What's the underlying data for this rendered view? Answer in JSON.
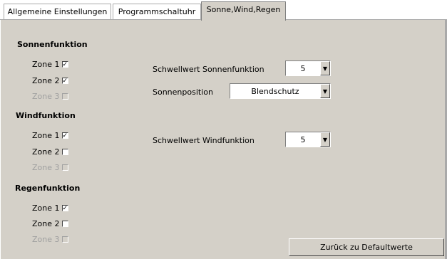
{
  "tabs": [
    {
      "label": "Allgemeine Einstellungen"
    },
    {
      "label": "Programmschaltuhr"
    },
    {
      "label": "Sonne,Wind,Regen"
    }
  ],
  "sonne": {
    "title": "Sonnenfunktion",
    "zones": [
      {
        "label": "Zone 1",
        "checked": true,
        "enabled": true
      },
      {
        "label": "Zone 2",
        "checked": true,
        "enabled": true
      },
      {
        "label": "Zone 3",
        "checked": false,
        "enabled": false
      }
    ],
    "threshold_label": "Schwellwert Sonnenfunktion",
    "threshold_value": "5",
    "position_label": "Sonnenposition",
    "position_value": "Blendschutz"
  },
  "wind": {
    "title": "Windfunktion",
    "zones": [
      {
        "label": "Zone 1",
        "checked": true,
        "enabled": true
      },
      {
        "label": "Zone 2",
        "checked": false,
        "enabled": true
      },
      {
        "label": "Zone 3",
        "checked": false,
        "enabled": false
      }
    ],
    "threshold_label": "Schwellwert Windfunktion",
    "threshold_value": "5"
  },
  "regen": {
    "title": "Regenfunktion",
    "zones": [
      {
        "label": "Zone 1",
        "checked": true,
        "enabled": true
      },
      {
        "label": "Zone 2",
        "checked": false,
        "enabled": true
      },
      {
        "label": "Zone 3",
        "checked": false,
        "enabled": false
      }
    ]
  },
  "reset_button": "Zurück zu Defaultwerte"
}
